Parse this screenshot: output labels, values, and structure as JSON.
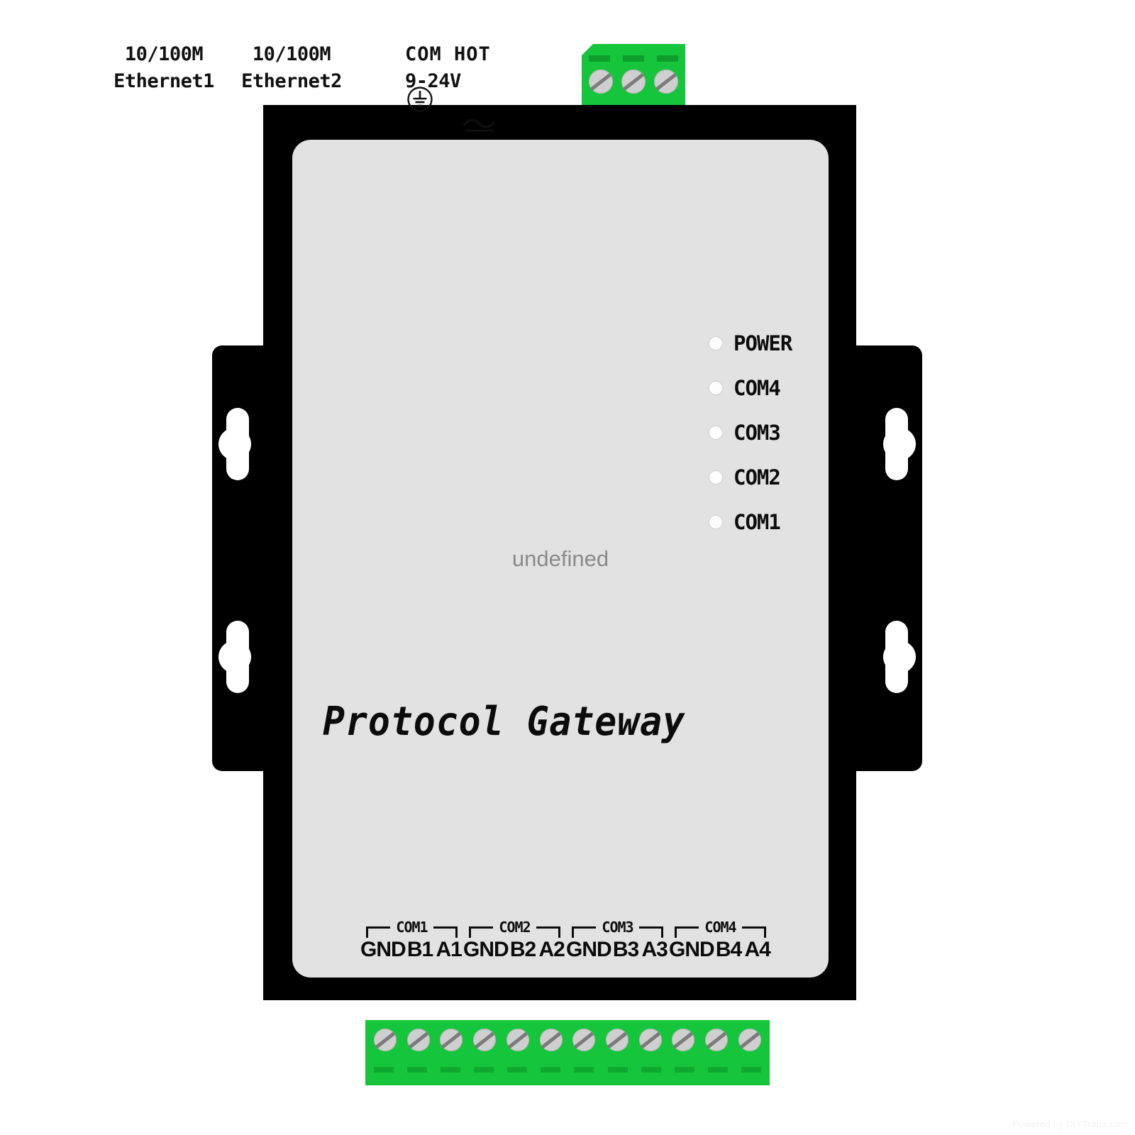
{
  "product": {
    "name": "Protocol Gateway",
    "placeholder_text": "undefined"
  },
  "top_ports": {
    "ethernet1": {
      "speed": "10/100M",
      "label": "Ethernet1"
    },
    "ethernet2": {
      "speed": "10/100M",
      "label": "Ethernet2"
    },
    "power": {
      "line1": "COM HOT",
      "line2": "9-24V",
      "ground_icon": "earth-ground-icon",
      "ac_icon": "ac-dc-symbol-icon"
    }
  },
  "leds": [
    {
      "label": "POWER",
      "color": "#fdfdfd"
    },
    {
      "label": "COM4",
      "color": "#fdfdfd"
    },
    {
      "label": "COM3",
      "color": "#fdfdfd"
    },
    {
      "label": "COM2",
      "color": "#fdfdfd"
    },
    {
      "label": "COM1",
      "color": "#fdfdfd"
    }
  ],
  "terminal_groups": [
    {
      "name": "COM1",
      "pins": [
        "GND",
        "B1",
        "A1"
      ]
    },
    {
      "name": "COM2",
      "pins": [
        "GND",
        "B2",
        "A2"
      ]
    },
    {
      "name": "COM3",
      "pins": [
        "GND",
        "B3",
        "A3"
      ]
    },
    {
      "name": "COM4",
      "pins": [
        "GND",
        "B4",
        "A4"
      ]
    }
  ],
  "connectors": {
    "top": {
      "pin_count": 3,
      "color": "#15c53b"
    },
    "bottom": {
      "pin_count": 12,
      "color": "#15c53b"
    }
  },
  "colors": {
    "enclosure": "#000000",
    "faceplate": "#e2e2e2",
    "connector_green": "#15c53b",
    "screw_silver": "#cfcfcf",
    "text": "#0b0b0b",
    "placeholder_text": "#8a8a8a"
  },
  "watermark": "Powered by DIYTrade.com"
}
